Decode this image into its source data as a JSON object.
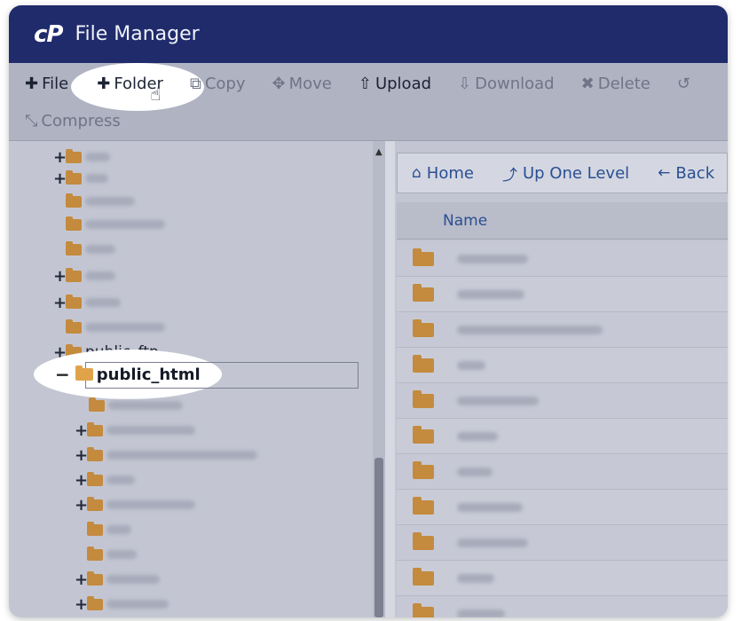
{
  "app": {
    "logo": "cP",
    "title": "File Manager"
  },
  "toolbar": {
    "file": "File",
    "folder": "Folder",
    "copy": "Copy",
    "move": "Move",
    "upload": "Upload",
    "download": "Download",
    "delete": "Delete",
    "compress": "Compress"
  },
  "tree": {
    "public_ftp": "public_ftp",
    "public_html": "public_html"
  },
  "nav": {
    "home": "Home",
    "up": "Up One Level",
    "back": "Back"
  },
  "table": {
    "name_header": "Name"
  },
  "colors": {
    "titlebar": "#1f2b6b",
    "folder": "#c48a3e",
    "link": "#2a4f93"
  }
}
